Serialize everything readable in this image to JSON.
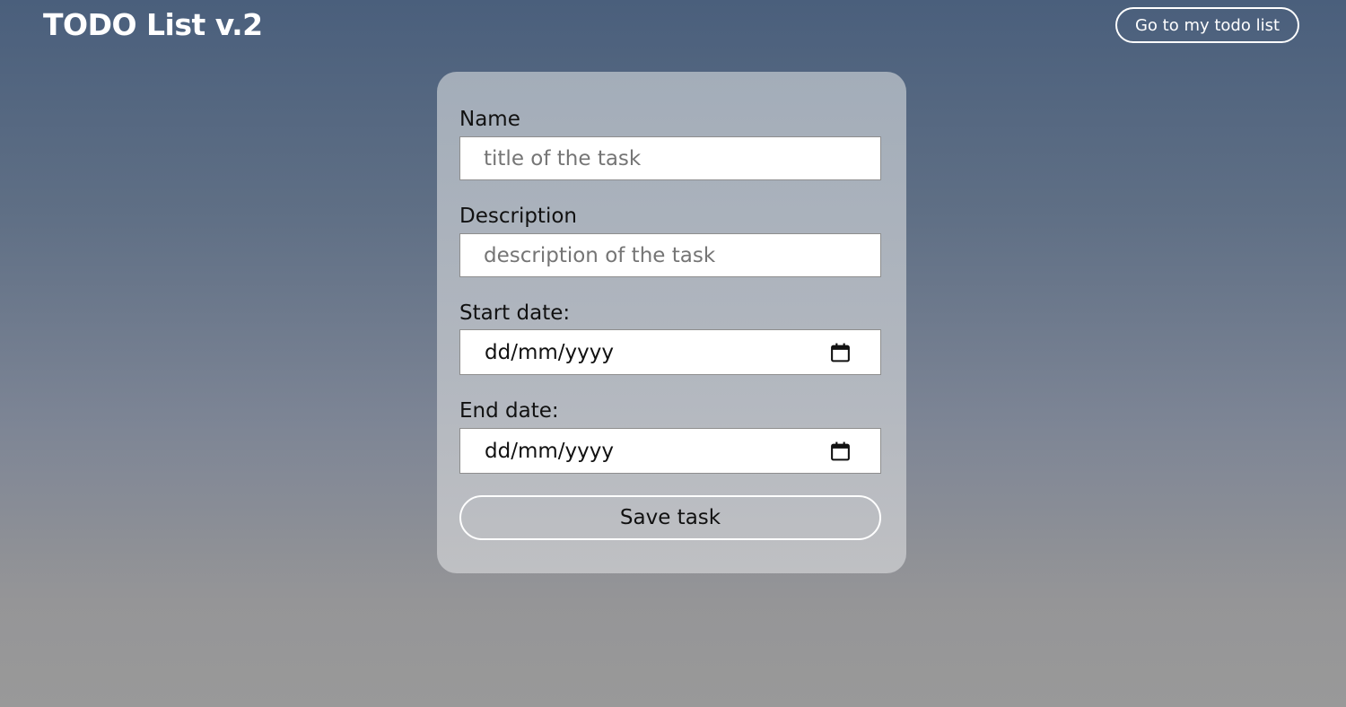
{
  "header": {
    "title": "TODO List v.2",
    "nav_button_label": "Go to my todo list"
  },
  "form": {
    "name": {
      "label": "Name",
      "placeholder": "title of the task",
      "value": ""
    },
    "description": {
      "label": "Description",
      "placeholder": "description of the task",
      "value": ""
    },
    "start_date": {
      "label": "Start date:",
      "value": "dd/mm/yyyy",
      "icon": "calendar-icon"
    },
    "end_date": {
      "label": "End date:",
      "value": "dd/mm/yyyy",
      "icon": "calendar-icon"
    },
    "save_label": "Save task"
  },
  "colors": {
    "background_top": "#4a5f7c",
    "background_bottom": "#999999",
    "card": "#b2b7bf",
    "text_on_background": "#ffffff"
  }
}
